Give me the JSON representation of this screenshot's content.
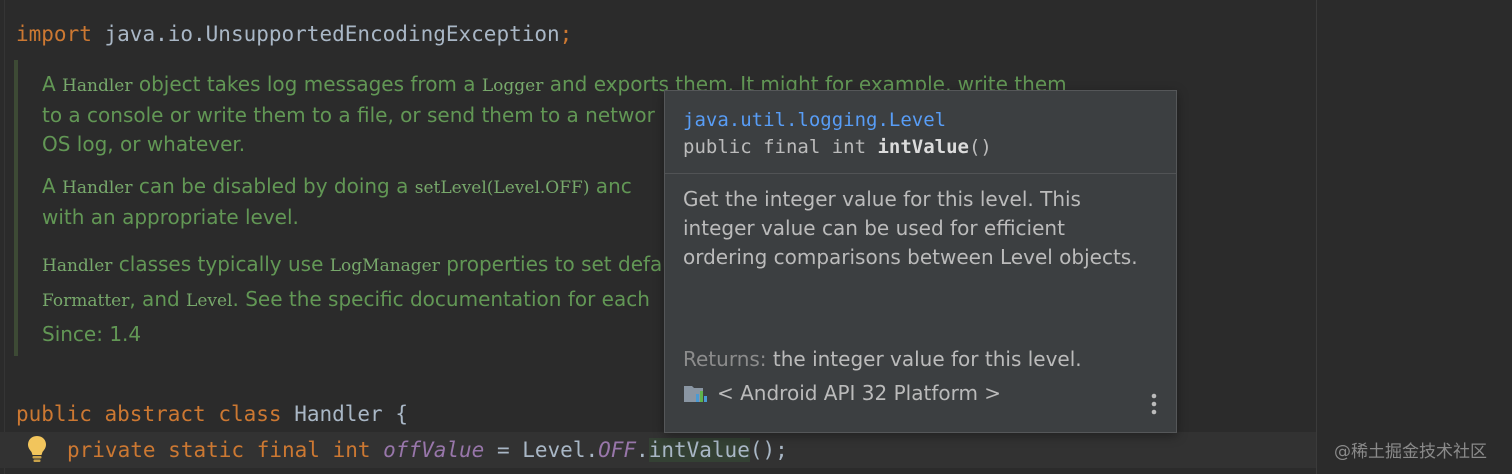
{
  "code": {
    "import_keyword": "import",
    "import_path": "java.io.UnsupportedEncodingException",
    "import_semicolon": ";",
    "class_line": {
      "kw_public": "public",
      "kw_abstract": "abstract",
      "kw_class": "class",
      "name": "Handler",
      "brace": "{"
    },
    "field_line": {
      "kw_private": "private",
      "kw_static": "static",
      "kw_final": "final",
      "kw_int": "int",
      "field": "offValue",
      "equals": " = ",
      "cls": "Level.",
      "constant": "OFF",
      "dot": ".",
      "method": "intValue",
      "tail": "();"
    }
  },
  "javadoc": {
    "p1": {
      "a": "A ",
      "c1": "Handler",
      "b": " object takes log messages from a ",
      "c2": "Logger",
      "d": " and exports them. It might for example, write them",
      "line2": "to a console or write them to a file, or send them to a networ",
      "line3": "OS log, or whatever."
    },
    "p2": {
      "a": "A ",
      "c1": "Handler",
      "b": " can be disabled by doing a ",
      "c2": "setLevel(Level.OFF)",
      "d": " anc",
      "line2": "with an appropriate level."
    },
    "p3": {
      "c1": "Handler",
      "a": " classes typically use ",
      "c2": "LogManager",
      "b": " properties to set defau",
      "c3": "Formatter",
      "d": ", and ",
      "c4": "Level",
      "e": ". See the specific documentation for each"
    },
    "since": "Since: 1.4"
  },
  "popup": {
    "package": "java.util.logging.Level",
    "signature_prefix": "public final int ",
    "signature_method": "intValue",
    "signature_suffix": "()",
    "description": "Get the integer value for this level. This integer value can be used for efficient ordering comparisons between Level objects.",
    "returns_label": "Returns:",
    "returns_text": " the integer value for this level.",
    "library": "< Android API 32 Platform >",
    "library_icon": "library-icon",
    "more_icon": "more-vertical-icon"
  },
  "watermark": "@稀土掘金技术社区",
  "colors": {
    "background": "#2b2b2b",
    "keyword": "#cc7832",
    "doc_comment": "#629755",
    "link": "#589df6"
  }
}
